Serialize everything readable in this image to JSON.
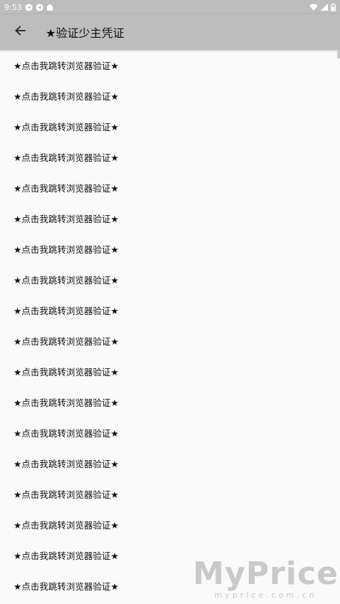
{
  "status_bar": {
    "time": "9:53",
    "left_icons": [
      "navigation-icon",
      "telegram-icon",
      "android-icon"
    ],
    "right_icons": [
      "wifi-icon",
      "cell-signal-icon",
      "battery-icon"
    ]
  },
  "app_bar": {
    "back_icon": "arrow-left-icon",
    "title": "★验证少主凭证"
  },
  "list": {
    "items": [
      "★点击我跳转浏览器验证★",
      "★点击我跳转浏览器验证★",
      "★点击我跳转浏览器验证★",
      "★点击我跳转浏览器验证★",
      "★点击我跳转浏览器验证★",
      "★点击我跳转浏览器验证★",
      "★点击我跳转浏览器验证★",
      "★点击我跳转浏览器验证★",
      "★点击我跳转浏览器验证★",
      "★点击我跳转浏览器验证★",
      "★点击我跳转浏览器验证★",
      "★点击我跳转浏览器验证★",
      "★点击我跳转浏览器验证★",
      "★点击我跳转浏览器验证★",
      "★点击我跳转浏览器验证★",
      "★点击我跳转浏览器验证★",
      "★点击我跳转浏览器验证★",
      "★点击我跳转浏览器验证★"
    ]
  },
  "watermark": {
    "brand": "MyPrice",
    "domain": "myprice.com.cn"
  },
  "colors": {
    "app_bar": "#bdbdbd",
    "background": "#fafafa",
    "text": "#111111"
  }
}
